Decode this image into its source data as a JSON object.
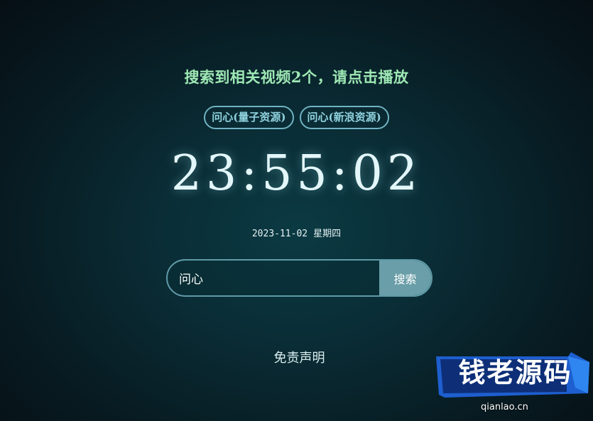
{
  "result": {
    "title": "搜索到相关视频2个，请点击播放"
  },
  "sources": [
    {
      "label": "问心(量子资源)"
    },
    {
      "label": "问心(新浪资源)"
    }
  ],
  "clock": {
    "time": "23:55:02",
    "date": "2023-11-02",
    "weekday": "星期四"
  },
  "search": {
    "value": "问心",
    "button_label": "搜索"
  },
  "footer": {
    "disclaimer": "免责声明"
  },
  "watermark": {
    "text": "钱老源码",
    "domain": "qianlao.cn"
  },
  "colors": {
    "title": "#9ee8b4",
    "pill_border": "#6fb3c2",
    "search_button": "#6a9ea8",
    "watermark_blue": "#1e5fd0"
  }
}
